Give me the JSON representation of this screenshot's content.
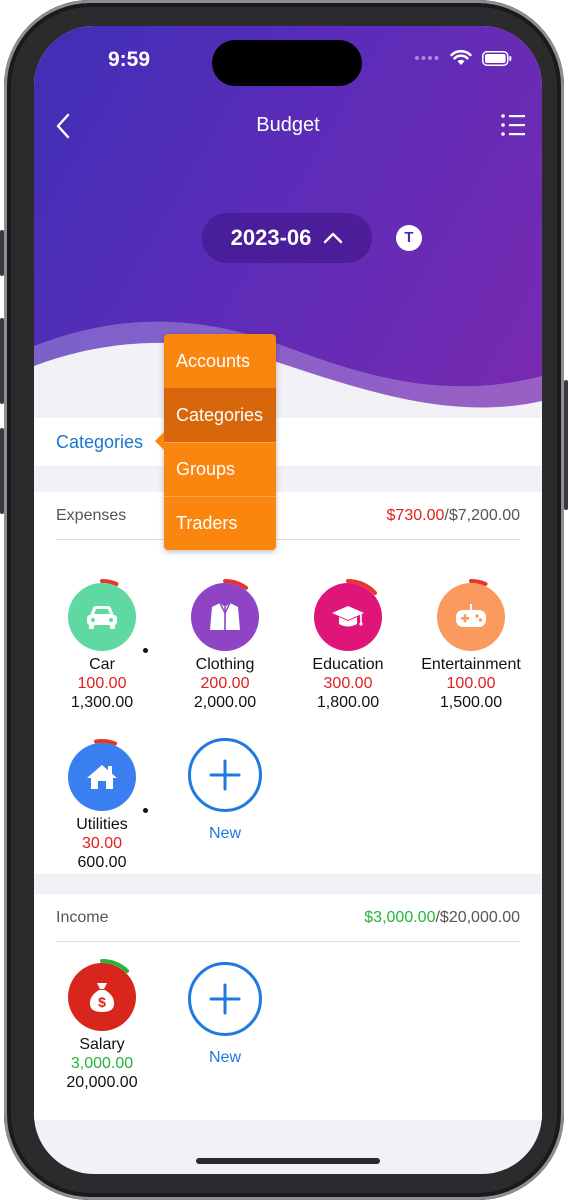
{
  "status": {
    "time": "9:59"
  },
  "nav": {
    "title": "Budget"
  },
  "month": {
    "label": "2023-06",
    "badge": "T"
  },
  "segment": {
    "label": "Categories"
  },
  "popover": {
    "items": [
      "Accounts",
      "Categories",
      "Groups",
      "Traders"
    ],
    "selected": "Categories"
  },
  "expenses": {
    "title": "Expenses",
    "used": "$730.00",
    "total": "/$7,200.00",
    "categories": [
      {
        "name": "Car",
        "spent": "100.00",
        "budget": "1,300.00",
        "icon": "car-icon",
        "color": "#5fd8a2"
      },
      {
        "name": "Clothing",
        "spent": "200.00",
        "budget": "2,000.00",
        "icon": "jacket-icon",
        "color": "#8e44c4"
      },
      {
        "name": "Education",
        "spent": "300.00",
        "budget": "1,800.00",
        "icon": "graduation-cap-icon",
        "color": "#e0157a"
      },
      {
        "name": "Entertainment",
        "spent": "100.00",
        "budget": "1,500.00",
        "icon": "gamepad-icon",
        "color": "#fb9a5e"
      },
      {
        "name": "Utilities",
        "spent": "30.00",
        "budget": "600.00",
        "icon": "house-icon",
        "color": "#3a7ff0"
      }
    ],
    "new_label": "New"
  },
  "income": {
    "title": "Income",
    "used": "$3,000.00",
    "total": "/$20,000.00",
    "categories": [
      {
        "name": "Salary",
        "spent": "3,000.00",
        "budget": "20,000.00",
        "icon": "money-bag-icon",
        "color": "#d8261c"
      }
    ],
    "new_label": "New"
  },
  "colors": {
    "accent": "#1e7ae0",
    "popover": "#fb860f",
    "expense_red": "#e02020",
    "income_green": "#25b33a"
  }
}
